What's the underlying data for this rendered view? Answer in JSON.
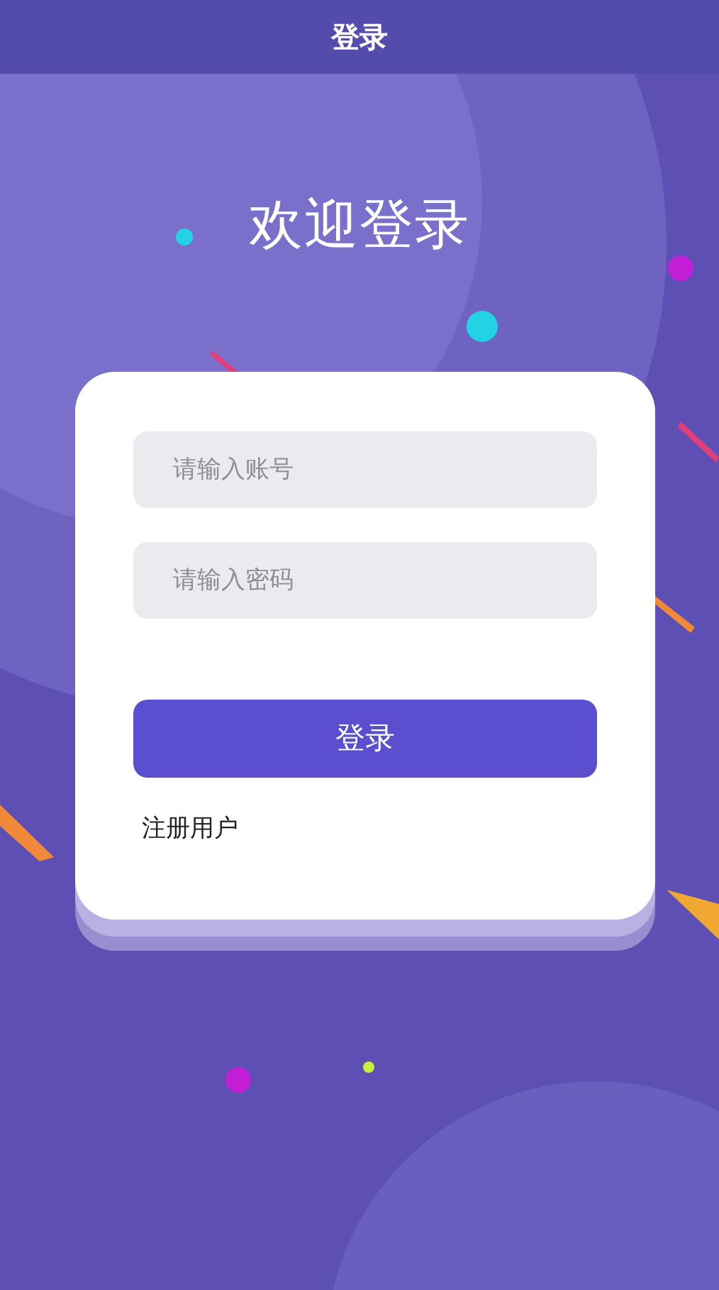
{
  "header": {
    "title": "登录"
  },
  "heading": "欢迎登录",
  "form": {
    "account": {
      "placeholder": "请输入账号"
    },
    "password": {
      "placeholder": "请输入密码"
    },
    "submit": "登录",
    "register_link": "注册用户"
  }
}
